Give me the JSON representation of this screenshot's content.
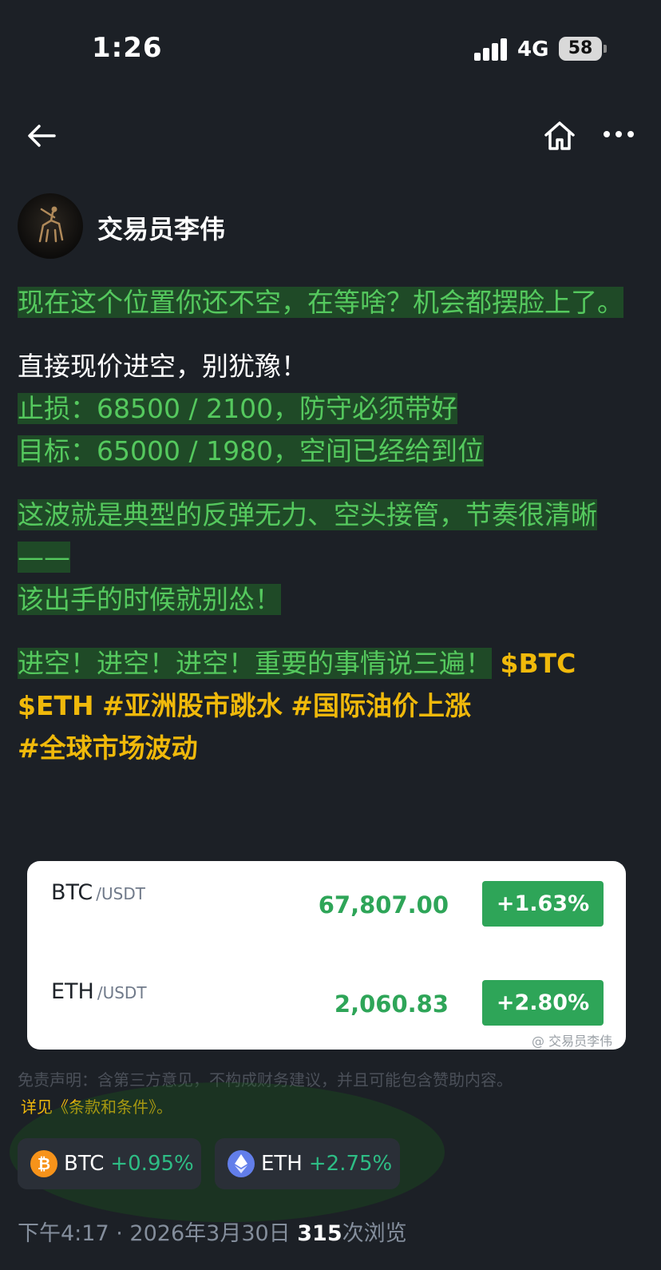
{
  "status_bar": {
    "time": "1:26",
    "network": "4G",
    "battery": "58"
  },
  "author": {
    "name": "交易员李伟"
  },
  "post": {
    "p1": "现在这个位置你还不空，在等啥？机会都摆脸上了。",
    "p2_l1": "直接现价进空，别犹豫！",
    "p2_l2": "止损：68500 / 2100，防守必须带好",
    "p2_l3": "目标：65000 / 1980，空间已经给到位",
    "p3_l1": "这波就是典型的反弹无力、空头接管，节奏很清晰——",
    "p3_l2": "该出手的时候就别怂！",
    "p4_text": "进空！进空！进空！重要的事情说三遍！",
    "tags": [
      "$BTC",
      "$ETH",
      "#亚洲股市跳水",
      "#国际油价上涨",
      "#全球市场波动"
    ]
  },
  "market_card": {
    "rows": [
      {
        "symbol": "BTC",
        "quote": "/USDT",
        "price": "67,807.00",
        "change": "+1.63%"
      },
      {
        "symbol": "ETH",
        "quote": "/USDT",
        "price": "2,060.83",
        "change": "+2.80%"
      }
    ],
    "watermark": "@ 交易员李伟"
  },
  "disclaimer": "免责声明：含第三方意见，不构成财务建议，并且可能包含赞助内容。",
  "terms_link": "详见《条款和条件》。",
  "coin_pills": [
    {
      "symbol": "BTC",
      "change": "+0.95%",
      "icon": "bitcoin-icon",
      "color": "#f7931a"
    },
    {
      "symbol": "ETH",
      "change": "+2.75%",
      "icon": "ethereum-icon",
      "color": "#627eea"
    }
  ],
  "meta": {
    "time": "下午4:17",
    "separator": "·",
    "date": "2026年3月30日",
    "views_count": "315",
    "views_label": "次浏览"
  },
  "colors": {
    "background": "#1c2026",
    "green": "#2ea558",
    "yellow": "#f0b90b",
    "highlight_text": "#55c95e"
  }
}
